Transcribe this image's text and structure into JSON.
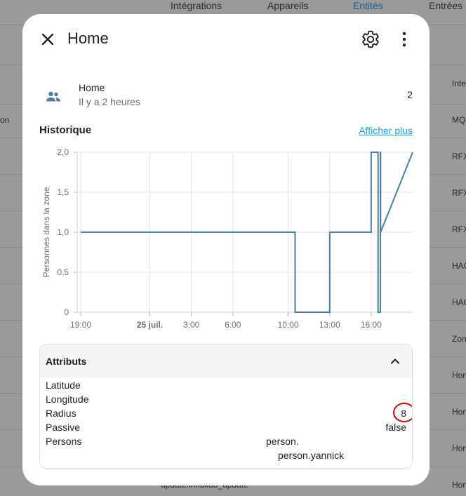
{
  "background": {
    "tabs": [
      "Intégrations",
      "Appareils",
      "Entités",
      "Entrées"
    ],
    "active_tab": "Entités",
    "left_text": "on",
    "right_column": [
      "Inte",
      "MQ",
      "RFX",
      "RFX",
      "RFX",
      "HAC",
      "HAC",
      "Zon",
      "Hon",
      "Hon",
      "Hon",
      "Hon"
    ],
    "bottom_text": "update.influxdb_update"
  },
  "dialog": {
    "title": "Home",
    "close_icon": "close-icon",
    "settings_icon": "gear-icon",
    "more_icon": "more-vert-icon"
  },
  "entity": {
    "icon": "people-icon",
    "name": "Home",
    "last_changed": "Il y a 2 heures",
    "state": "2"
  },
  "history": {
    "title": "Historique",
    "show_more": "Afficher plus"
  },
  "chart_data": {
    "type": "line",
    "ylabel": "Personnes dans la zone",
    "xlabel": "",
    "ylim": [
      0,
      2
    ],
    "y_ticks": [
      "2,0",
      "1,5",
      "1,0",
      "0,5",
      "0"
    ],
    "x_ticks": [
      "19:00",
      "25 juil.",
      "3:00",
      "6:00",
      "10:00",
      "13:00",
      "16:00"
    ],
    "color": "#4a7da8",
    "series": [
      {
        "x": [
          "19:00",
          "10:30",
          "10:30",
          "13:00",
          "13:00",
          "16:00",
          "16:00",
          "16:30",
          "16:30",
          "16:40",
          "16:40",
          "16:41",
          "16:41",
          "19:00"
        ],
        "values": [
          1,
          1,
          0,
          0,
          1,
          1,
          2,
          2,
          0,
          0,
          2,
          2,
          1,
          2
        ]
      }
    ]
  },
  "attributes": {
    "title": "Attributs",
    "chevron_icon": "chevron-up-icon",
    "rows": [
      {
        "label": "Latitude",
        "value": ""
      },
      {
        "label": "Longitude",
        "value": ""
      },
      {
        "label": "Radius",
        "value": "8"
      },
      {
        "label": "Passive",
        "value": "false"
      },
      {
        "label": "Persons",
        "value": "person."
      }
    ],
    "persons_extra": "person.yannick"
  },
  "colors": {
    "link": "#03a9f4",
    "line": "#4a7da8",
    "highlight": "#e00000",
    "entity_icon": "#4a7da8"
  }
}
